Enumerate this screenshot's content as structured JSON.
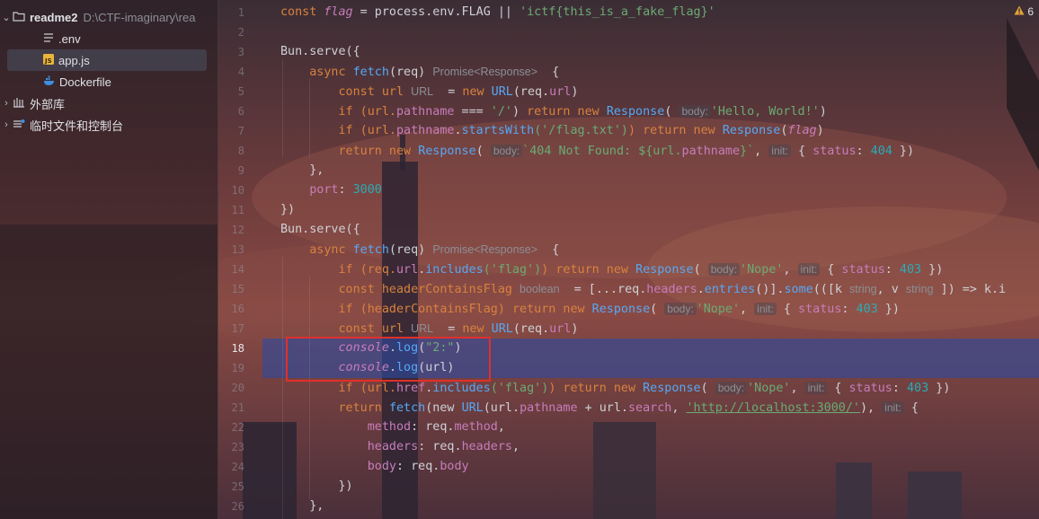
{
  "project_tree": {
    "root": {
      "name": "readme2",
      "path": "D:\\CTF-imaginary\\rea"
    },
    "files": [
      {
        "name": ".env",
        "icon": "lines-file-icon"
      },
      {
        "name": "app.js",
        "icon": "js-file-icon",
        "selected": true
      },
      {
        "name": "Dockerfile",
        "icon": "docker-icon"
      }
    ],
    "external_libraries": "外部库",
    "scratches": "临时文件和控制台"
  },
  "editor": {
    "line_numbers": [
      "1",
      "2",
      "3",
      "4",
      "5",
      "6",
      "7",
      "8",
      "9",
      "10",
      "11",
      "12",
      "13",
      "14",
      "15",
      "16",
      "17",
      "18",
      "19",
      "20",
      "21",
      "22",
      "23",
      "24",
      "25",
      "26"
    ],
    "current_line": "18",
    "warnings_count": "6",
    "hints": {
      "promise_response": "Promise<Response>",
      "url_type": "URL",
      "body": "body:",
      "init": "init:",
      "boolean": "boolean",
      "string": "string"
    },
    "code": {
      "l1_a": "const ",
      "l1_b": "flag",
      "l1_c": " = process.env.FLAG || ",
      "l1_d": "'ictf{this_is_a_fake_flag}'",
      "l3": "Bun.serve({",
      "l4_a": "    async ",
      "l4_b": "fetch",
      "l4_c": "(req) ",
      "l4_d": "  {",
      "l5_a": "        const url ",
      "l5_b": "  = ",
      "l5_c": "new ",
      "l5_d": "URL",
      "l5_e": "(req.",
      "l5_f": "url",
      "l5_g": ")",
      "l6_a": "        if (url.",
      "l6_b": "pathname",
      "l6_c": " === ",
      "l6_d": "'/'",
      "l6_e": ") ",
      "l6_f": "return new ",
      "l6_g": "Response",
      "l6_h": "( ",
      "l6_i": "'Hello, World!'",
      "l6_j": ")",
      "l7_a": "        if (url.",
      "l7_b": "pathname",
      "l7_c": ".",
      "l7_d": "startsWith",
      "l7_e": "('/flag.txt')",
      "l7_f": ") return new ",
      "l7_g": "Response",
      "l7_h": "(",
      "l7_i": "flag",
      "l7_j": ")",
      "l8_a": "        return new ",
      "l8_b": "Response",
      "l8_c": "( ",
      "l8_d": "`404 Not Found: ${url.",
      "l8_e": "pathname",
      "l8_f": "}`",
      "l8_g": ", ",
      "l8_h": " { ",
      "l8_i": "status",
      "l8_j": ": ",
      "l8_k": "404",
      "l8_l": " })",
      "l9": "    },",
      "l10_a": "    ",
      "l10_b": "port",
      "l10_c": ": ",
      "l10_d": "3000",
      "l11": "})",
      "l12": "Bun.serve({",
      "l13_a": "    async ",
      "l13_b": "fetch",
      "l13_c": "(req) ",
      "l13_d": "  {",
      "l14_a": "        if (req.",
      "l14_b": "url",
      "l14_c": ".",
      "l14_d": "includes",
      "l14_e": "('flag')",
      "l14_f": ") return new ",
      "l14_g": "Response",
      "l14_h": "( ",
      "l14_i": "'Nope'",
      "l14_j": ", ",
      "l14_k": " { ",
      "l14_l": "status",
      "l14_m": ": ",
      "l14_n": "403",
      "l14_o": " })",
      "l15_a": "        const headerContainsFlag ",
      "l15_b": "  = [...req.",
      "l15_c": "headers",
      "l15_d": ".",
      "l15_e": "entries",
      "l15_f": "()].",
      "l15_g": "some",
      "l15_h": "(([k ",
      "l15_i": ", v ",
      "l15_j": " ]) => k.i",
      "l16_a": "        if (headerContainsFlag) return new ",
      "l16_b": "Response",
      "l16_c": "( ",
      "l16_d": "'Nope'",
      "l16_e": ", ",
      "l16_f": " { ",
      "l16_g": "status",
      "l16_h": ": ",
      "l16_i": "403",
      "l16_j": " })",
      "l17_a": "        const url ",
      "l17_b": "  = ",
      "l17_c": "new ",
      "l17_d": "URL",
      "l17_e": "(req.",
      "l17_f": "url",
      "l17_g": ")",
      "l18_a": "        ",
      "l18_b": "console",
      "l18_c": ".",
      "l18_d": "log",
      "l18_e": "(",
      "l18_f": "\"2:\"",
      "l18_g": ")",
      "l19_a": "        ",
      "l19_b": "console",
      "l19_c": ".",
      "l19_d": "log",
      "l19_e": "(url)",
      "l20_a": "        if (url.",
      "l20_b": "href",
      "l20_c": ".",
      "l20_d": "includes",
      "l20_e": "('flag')",
      "l20_f": ") return new ",
      "l20_g": "Response",
      "l20_h": "( ",
      "l20_i": "'Nope'",
      "l20_j": ", ",
      "l20_k": " { ",
      "l20_l": "status",
      "l20_m": ": ",
      "l20_n": "403",
      "l20_o": " })",
      "l21_a": "        return ",
      "l21_b": "fetch",
      "l21_c": "(new ",
      "l21_d": "URL",
      "l21_e": "(url.",
      "l21_f": "pathname",
      "l21_g": " + url.",
      "l21_h": "search",
      "l21_i": ", ",
      "l21_j": "'http://localhost:3000/'",
      "l21_k": "), ",
      "l21_l": " {",
      "l22_a": "            ",
      "l22_b": "method",
      "l22_c": ": req.",
      "l22_d": "method",
      "l22_e": ",",
      "l23_a": "            ",
      "l23_b": "headers",
      "l23_c": ": req.",
      "l23_d": "headers",
      "l23_e": ",",
      "l24_a": "            ",
      "l24_b": "body",
      "l24_c": ": req.",
      "l24_d": "body",
      "l25": "        })",
      "l26": "    },"
    }
  }
}
